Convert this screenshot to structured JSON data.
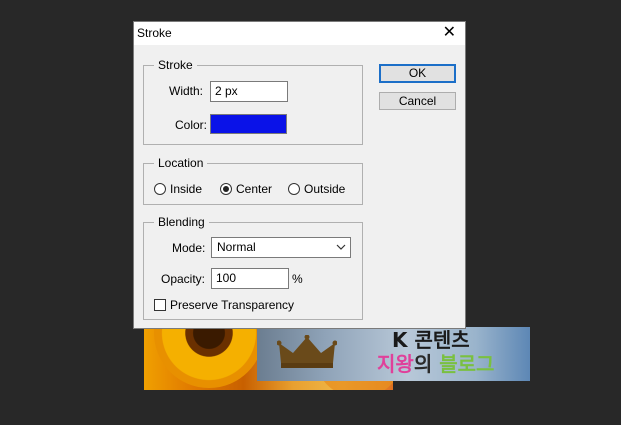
{
  "dialog": {
    "title": "Stroke",
    "close_label": "✕",
    "stroke_group": {
      "legend": "Stroke",
      "width_label": "Width:",
      "width_value": "2 px",
      "color_label": "Color:",
      "color_value": "#0a12e8"
    },
    "location_group": {
      "legend": "Location",
      "options": [
        {
          "label": "Inside",
          "selected": false
        },
        {
          "label": "Center",
          "selected": true
        },
        {
          "label": "Outside",
          "selected": false
        }
      ]
    },
    "blending_group": {
      "legend": "Blending",
      "mode_label": "Mode:",
      "mode_value": "Normal",
      "opacity_label": "Opacity:",
      "opacity_value": "100",
      "opacity_unit": "%",
      "preserve_label": "Preserve Transparency",
      "preserve_checked": false
    },
    "buttons": {
      "ok": "OK",
      "cancel": "Cancel"
    }
  },
  "background": {
    "logo_line1": "K 콘텐츠",
    "logo_line2_a": "지왕",
    "logo_line2_b": "의 ",
    "logo_line2_c": "블로그"
  }
}
